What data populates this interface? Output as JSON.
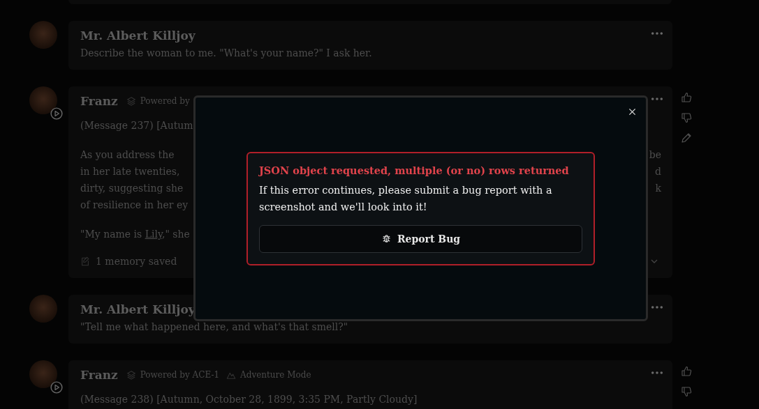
{
  "messages": [
    {
      "author": "Mr. Albert Killjoy",
      "paragraphs": [
        {
          "kind": "plain",
          "text": "Describe the woman to me. \"What's your name?\" I ask her."
        }
      ]
    },
    {
      "author": "Franz",
      "avatar_play": true,
      "badges": [
        {
          "kind": "model",
          "text": "Powered by"
        }
      ],
      "header_line": "(Message 237) [Autum",
      "paragraphs": [
        {
          "kind": "split",
          "lines": [
            {
              "left": "As you address the",
              "right": "be"
            },
            {
              "left": "in her late twenties,",
              "right": "d"
            },
            {
              "left": "dirty, suggesting she",
              "right": "k"
            },
            {
              "left": "of resilience in her ey"
            }
          ]
        },
        {
          "kind": "link",
          "before": "\"My name is ",
          "link": "Lily",
          "after": ",\" she"
        }
      ],
      "memory": {
        "text": "1 memory saved",
        "expandable": true
      },
      "rateable": true,
      "editable": true
    },
    {
      "author": "Mr. Albert Killjoy",
      "paragraphs": [
        {
          "kind": "plain",
          "text": "\"Tell me what happened here, and what's that smell?\""
        }
      ]
    },
    {
      "author": "Franz",
      "avatar_play": true,
      "badges": [
        {
          "kind": "model",
          "text": "Powered by ACE-1"
        },
        {
          "kind": "mode",
          "text": "Adventure Mode"
        }
      ],
      "header_line": "(Message 238) [Autumn, October 28, 1899, 3:35 PM, Partly Cloudy]",
      "rateable": true
    }
  ],
  "error_dialog": {
    "title": "JSON object requested, multiple (or no) rows returned",
    "message": "If this error continues, please submit a bug report with a screenshot and we'll look into it!",
    "button": "Report Bug"
  }
}
